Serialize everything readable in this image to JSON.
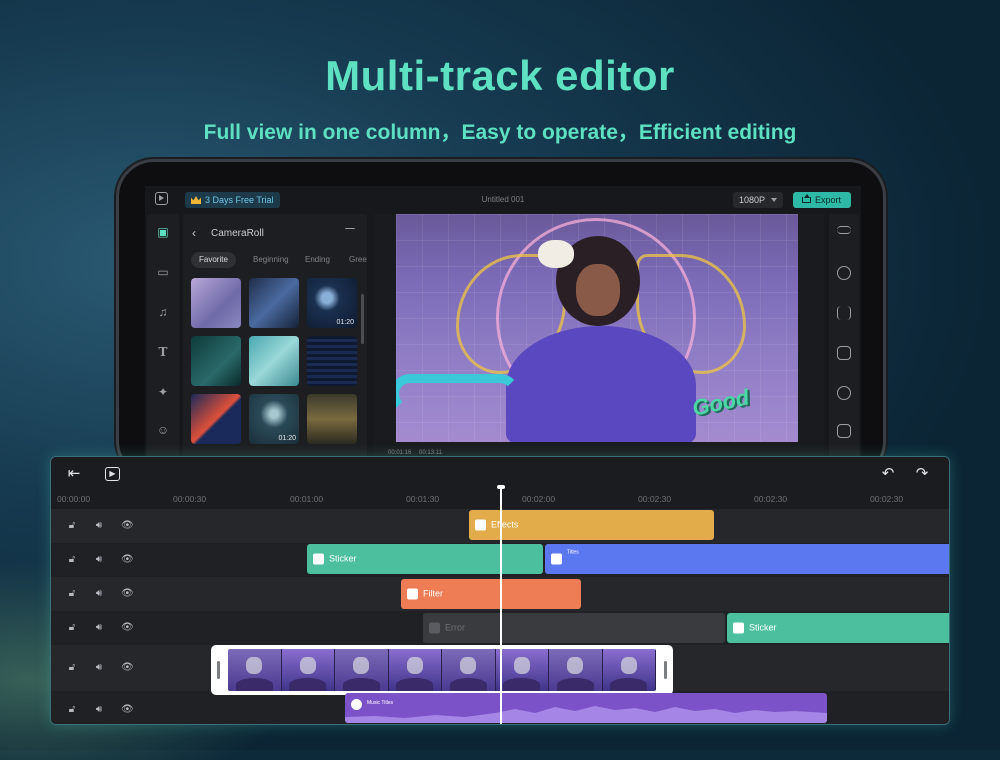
{
  "headline": "Multi-track editor",
  "subline": "Full view in one column，Easy to operate，Efficient editing",
  "colors": {
    "accent": "#5ee0c2",
    "effects": "#e2ac4a",
    "sticker": "#4bbf9e",
    "text": "#5c78f0",
    "filter": "#ee7d55",
    "error": "#3a3b3f",
    "music": "#7b52c8"
  },
  "app": {
    "trial_badge": "3 Days Free Trial",
    "doc_title": "Untitled 001",
    "resolution": "1080P",
    "export_label": "Export",
    "media": {
      "title": "CameraRoll",
      "tabs": [
        "Favorite",
        "Beginning",
        "Ending",
        "Gree"
      ],
      "thumb_durations": [
        "01:20",
        "01:20"
      ]
    },
    "preview": {
      "current_time": "00:01:16",
      "total_time": "00:13:11",
      "sticker_text": "Good"
    },
    "left_rail_icons": [
      "media-icon",
      "folder-icon",
      "music-icon",
      "text-icon",
      "effects-icon",
      "sticker-icon"
    ],
    "right_rail_icons": [
      "adjust-icon",
      "speed-icon",
      "audio-icon",
      "crop-icon",
      "filter-icon",
      "mask-icon"
    ]
  },
  "timeline": {
    "ticks": [
      "00:00:00",
      "00:00:30",
      "00:01:00",
      "00:01:30",
      "00:02:00",
      "00:02:30",
      "00:02:30",
      "00:02:30"
    ],
    "tracks": [
      {
        "clips": [
          {
            "label": "Effects",
            "type": "effects"
          }
        ]
      },
      {
        "clips": [
          {
            "label": "Sticker",
            "type": "sticker"
          },
          {
            "label": "Titles",
            "type": "text"
          }
        ]
      },
      {
        "clips": [
          {
            "label": "Filter",
            "type": "filter"
          }
        ]
      },
      {
        "clips": [
          {
            "label": "Error",
            "type": "error"
          },
          {
            "label": "Sticker",
            "type": "sticker"
          }
        ]
      },
      {
        "clips": [
          {
            "label": "",
            "type": "video"
          }
        ]
      },
      {
        "clips": [
          {
            "label": "Music Titles",
            "type": "music"
          }
        ]
      }
    ]
  }
}
